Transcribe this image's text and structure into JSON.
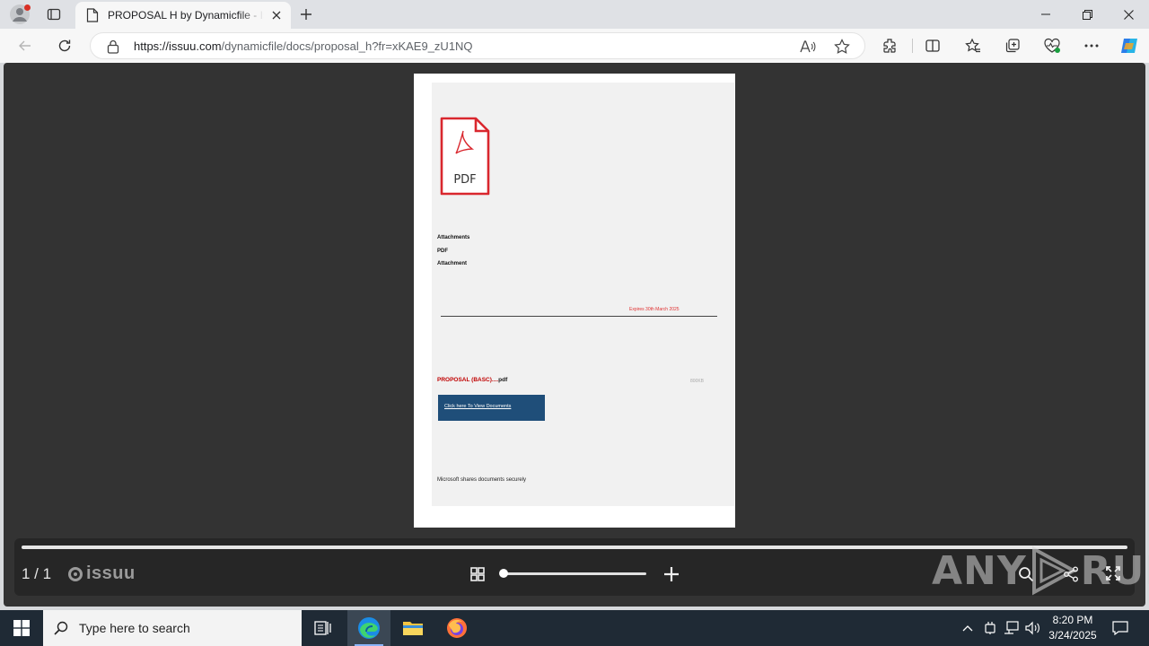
{
  "browser": {
    "tab_title": "PROPOSAL H by Dynamicfile - Issuu",
    "url_host": "https://issuu.com",
    "url_path": "/dynamicfile/docs/proposal_h?fr=xKAE9_zU1NQ",
    "icons": [
      "profile-icon",
      "tab-actions-icon",
      "page-icon",
      "close-icon",
      "plus-icon",
      "minimize-icon",
      "restore-icon",
      "window-close-icon",
      "back-icon",
      "refresh-icon",
      "lock-icon",
      "read-aloud-icon",
      "star-icon",
      "extensions-icon",
      "split-screen-icon",
      "favorites-icon",
      "collections-icon",
      "performance-icon",
      "more-icon",
      "copilot-icon"
    ]
  },
  "document": {
    "pdf_label": "PDF",
    "attachments_heading": "Attachments",
    "pdf_line": "PDF",
    "attachment_line": "Attachment",
    "expires": "Expires 30th March 2025",
    "proposal_name": "PROPOSAL (BASC)....",
    "proposal_ext": "pdf",
    "size_label": "800KB",
    "view_button": "Click here To View Documents",
    "footer_note": "Microsoft shares documents securely"
  },
  "viewer": {
    "page_indicator": "1 / 1",
    "brand": "issuu",
    "zoom_level": 0,
    "watermark_left": "ANY",
    "watermark_right": "RUN"
  },
  "taskbar": {
    "search_placeholder": "Type here to search",
    "time": "8:20 PM",
    "date": "3/24/2025"
  },
  "colors": {
    "accent_red": "#e03030",
    "doc_button_blue": "#1f4e79",
    "viewer_bg": "#333333",
    "taskbar_bg": "#1f2a35"
  }
}
